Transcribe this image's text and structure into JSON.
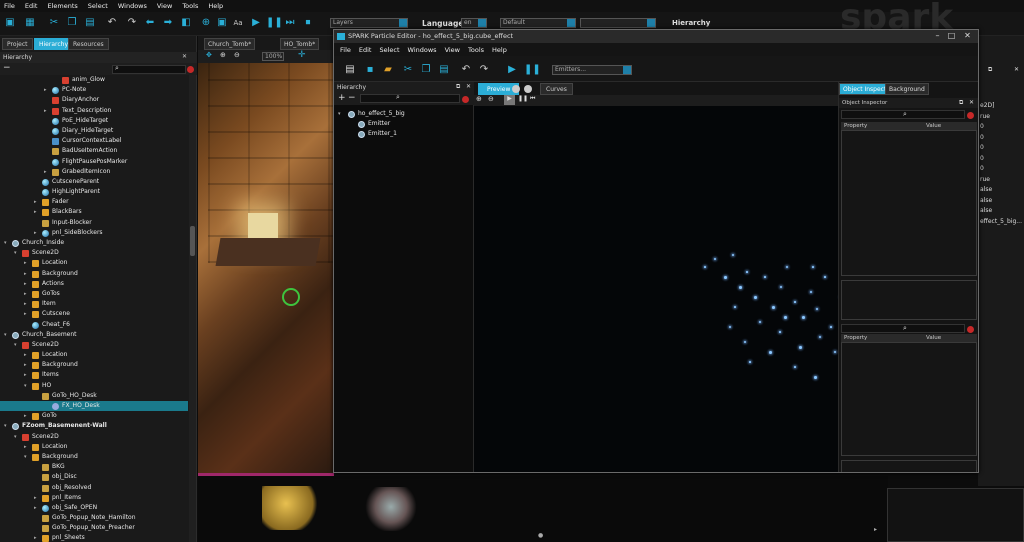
{
  "menubar": {
    "items": [
      "File",
      "Edit",
      "Elements",
      "Select",
      "Windows",
      "View",
      "Tools",
      "Help"
    ]
  },
  "toolbar": {
    "layers_placeholder": "Layers",
    "language_label": "Language:",
    "language_value": "en",
    "default_value": "Default",
    "hierarchy_label": "Hierarchy"
  },
  "left_panel": {
    "tabs": [
      "Project",
      "Hierarchy",
      "Resources"
    ],
    "active_tab": "Hierarchy",
    "title": "Hierarchy",
    "tree": [
      {
        "label": "anim_Glow",
        "depth": 5,
        "icon": "scene",
        "toggle": ""
      },
      {
        "label": "PC-Note",
        "depth": 4,
        "icon": "sphere",
        "toggle": "▸"
      },
      {
        "label": "DiaryAnchor",
        "depth": 4,
        "icon": "scene",
        "toggle": ""
      },
      {
        "label": "Text_Description",
        "depth": 4,
        "icon": "scene",
        "toggle": "▸"
      },
      {
        "label": "PoE_HideTarget",
        "depth": 4,
        "icon": "sphere",
        "toggle": ""
      },
      {
        "label": "Diary_HideTarget",
        "depth": 4,
        "icon": "sphere",
        "toggle": ""
      },
      {
        "label": "CursorContextLabel",
        "depth": 4,
        "icon": "cube",
        "toggle": ""
      },
      {
        "label": "BadUseItemAction",
        "depth": 4,
        "icon": "img",
        "toggle": ""
      },
      {
        "label": "FlightPausePosMarker",
        "depth": 4,
        "icon": "sphere",
        "toggle": ""
      },
      {
        "label": "GrabedItemIcon",
        "depth": 4,
        "icon": "img",
        "toggle": "▸"
      },
      {
        "label": "CutsceneParent",
        "depth": 3,
        "icon": "sphere",
        "toggle": ""
      },
      {
        "label": "HighLightParent",
        "depth": 3,
        "icon": "sphere",
        "toggle": ""
      },
      {
        "label": "Fader",
        "depth": 3,
        "icon": "folder",
        "toggle": "▸"
      },
      {
        "label": "BlackBars",
        "depth": 3,
        "icon": "folder",
        "toggle": "▸"
      },
      {
        "label": "Input-Blocker",
        "depth": 3,
        "icon": "img",
        "toggle": ""
      },
      {
        "label": "pnl_SideBlockers",
        "depth": 3,
        "icon": "sphere",
        "toggle": "▸"
      },
      {
        "label": "Church_Inside",
        "depth": 0,
        "icon": "gear",
        "toggle": "▾"
      },
      {
        "label": "Scene2D",
        "depth": 1,
        "icon": "scene",
        "toggle": "▾"
      },
      {
        "label": "Location",
        "depth": 2,
        "icon": "folder",
        "toggle": "▸"
      },
      {
        "label": "Background",
        "depth": 2,
        "icon": "folder",
        "toggle": "▸"
      },
      {
        "label": "Actions",
        "depth": 2,
        "icon": "folder",
        "toggle": "▸"
      },
      {
        "label": "GoTos",
        "depth": 2,
        "icon": "folder",
        "toggle": "▸"
      },
      {
        "label": "Item",
        "depth": 2,
        "icon": "folder",
        "toggle": "▸"
      },
      {
        "label": "Cutscene",
        "depth": 2,
        "icon": "folder",
        "toggle": "▸"
      },
      {
        "label": "Cheat_F6",
        "depth": 2,
        "icon": "sphere",
        "toggle": ""
      },
      {
        "label": "Church_Basement",
        "depth": 0,
        "icon": "gear",
        "toggle": "▾"
      },
      {
        "label": "Scene2D",
        "depth": 1,
        "icon": "scene",
        "toggle": "▾"
      },
      {
        "label": "Location",
        "depth": 2,
        "icon": "folder",
        "toggle": "▸"
      },
      {
        "label": "Background",
        "depth": 2,
        "icon": "folder",
        "toggle": "▸"
      },
      {
        "label": "Items",
        "depth": 2,
        "icon": "folder",
        "toggle": "▸"
      },
      {
        "label": "HO",
        "depth": 2,
        "icon": "folder",
        "toggle": "▾"
      },
      {
        "label": "GoTo_HO_Desk",
        "depth": 3,
        "icon": "img",
        "toggle": ""
      },
      {
        "label": "FX_HO_Desk",
        "depth": 4,
        "icon": "fx",
        "toggle": "",
        "selected": true
      },
      {
        "label": "GoTo",
        "depth": 2,
        "icon": "folder",
        "toggle": "▸"
      },
      {
        "label": "FZoom_Basemenent-Wall",
        "depth": 0,
        "icon": "gear",
        "toggle": "▾",
        "bold": true
      },
      {
        "label": "Scene2D",
        "depth": 1,
        "icon": "scene",
        "toggle": "▾"
      },
      {
        "label": "Location",
        "depth": 2,
        "icon": "folder",
        "toggle": "▸"
      },
      {
        "label": "Background",
        "depth": 2,
        "icon": "folder",
        "toggle": "▾"
      },
      {
        "label": "BKG",
        "depth": 3,
        "icon": "img",
        "toggle": ""
      },
      {
        "label": "obj_Disc",
        "depth": 3,
        "icon": "img",
        "toggle": ""
      },
      {
        "label": "obj_Resolved",
        "depth": 3,
        "icon": "img",
        "toggle": ""
      },
      {
        "label": "pnl_Items",
        "depth": 3,
        "icon": "folder",
        "toggle": "▸"
      },
      {
        "label": "obj_Safe_OPEN",
        "depth": 3,
        "icon": "sphere",
        "toggle": "▸"
      },
      {
        "label": "GoTo_Popup_Note_Hamilton",
        "depth": 3,
        "icon": "img",
        "toggle": ""
      },
      {
        "label": "GoTo_Popup_Note_Preacher",
        "depth": 3,
        "icon": "img",
        "toggle": ""
      },
      {
        "label": "pnl_Sheets",
        "depth": 3,
        "icon": "folder",
        "toggle": "▸"
      }
    ]
  },
  "scene_view": {
    "tabs": [
      "Church_Tomb*",
      "HO_Tomb*"
    ],
    "zoom": "100%"
  },
  "spark": {
    "title": "SPARK Particle Editor - ho_effect_5_big.cube_effect",
    "menu": [
      "File",
      "Edit",
      "Select",
      "Windows",
      "View",
      "Tools",
      "Help"
    ],
    "emitters_placeholder": "Emitters...",
    "hierarchy_title": "Hierarchy",
    "tree": [
      {
        "label": "ho_effect_5_big",
        "depth": 0
      },
      {
        "label": "Emitter",
        "depth": 1
      },
      {
        "label": "Emitter_1",
        "depth": 1
      }
    ],
    "preview_tabs": [
      "Preview",
      "Curves"
    ],
    "inspector_tabs": [
      "Object Inspector",
      "Background"
    ],
    "inspector_title": "Object Inspector",
    "property_label": "Property",
    "value_label": "Value"
  },
  "right_panel": {
    "values": [
      "e2D]",
      "rue",
      "0",
      "0",
      "0",
      "0",
      "0",
      "rue",
      "alse",
      "alse",
      "alse",
      "effect_5_big..."
    ]
  },
  "logo_text": "spark",
  "colors": {
    "accent": "#2badd6",
    "selected_row": "#1a7a8c",
    "close_red": "#c62828"
  }
}
